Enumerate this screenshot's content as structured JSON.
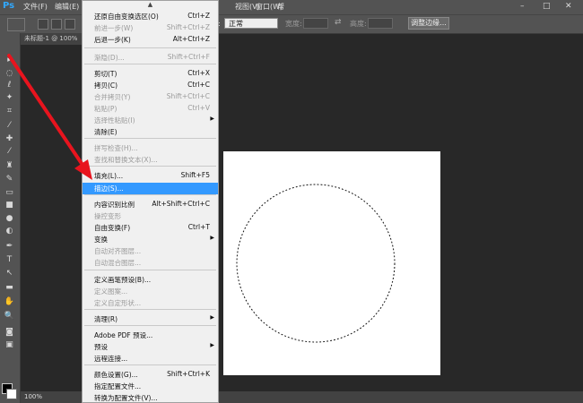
{
  "menubar": {
    "logo": "Ps",
    "file": "文件(F)",
    "edit": "编辑(E)",
    "view": "视图(V)",
    "window": "窗口(W)",
    "help": "帮",
    "minimize": "–",
    "maximize": "□",
    "close": "✕"
  },
  "options": {
    "style_label": "式:",
    "style_value": "正常",
    "width_label": "宽度:",
    "height_label": "高度:",
    "swap_icon": "⇄",
    "refine_button": "调整边缘..."
  },
  "document": {
    "tab_title": "未标题-1 @ 100%",
    "zoom": "100%"
  },
  "tools": [
    {
      "icon": "move-icon",
      "glyph": "▸"
    },
    {
      "icon": "marquee-icon",
      "glyph": "◌"
    },
    {
      "icon": "lasso-icon",
      "glyph": "ℓ"
    },
    {
      "icon": "magic-wand-icon",
      "glyph": "✦"
    },
    {
      "icon": "crop-icon",
      "glyph": "⌗"
    },
    {
      "icon": "eyedropper-icon",
      "glyph": "⁄"
    },
    {
      "icon": "healing-icon",
      "glyph": "✚"
    },
    {
      "icon": "brush-icon",
      "glyph": "⁄"
    },
    {
      "icon": "stamp-icon",
      "glyph": "♜"
    },
    {
      "icon": "history-brush-icon",
      "glyph": "✎"
    },
    {
      "icon": "eraser-icon",
      "glyph": "▭"
    },
    {
      "icon": "gradient-icon",
      "glyph": "■"
    },
    {
      "icon": "blur-icon",
      "glyph": "●"
    },
    {
      "icon": "dodge-icon",
      "glyph": "◐"
    },
    {
      "icon": "pen-icon",
      "glyph": "✒"
    },
    {
      "icon": "type-icon",
      "glyph": "T"
    },
    {
      "icon": "path-select-icon",
      "glyph": "↖"
    },
    {
      "icon": "shape-icon",
      "glyph": "▬"
    },
    {
      "icon": "hand-icon",
      "glyph": "✋"
    },
    {
      "icon": "zoom-icon",
      "glyph": "🔍"
    },
    {
      "icon": "quick-mask-icon",
      "glyph": "◙"
    },
    {
      "icon": "screen-mode-icon",
      "glyph": "▣"
    }
  ],
  "edit_menu": {
    "scroll_up": "▲",
    "items": [
      {
        "label": "还原自由变换选区(O)",
        "shortcut": "Ctrl+Z",
        "disabled": false
      },
      {
        "label": "前进一步(W)",
        "shortcut": "Shift+Ctrl+Z",
        "disabled": true
      },
      {
        "label": "后退一步(K)",
        "shortcut": "Alt+Ctrl+Z",
        "disabled": false
      },
      {
        "label": "渐隐(D)...",
        "shortcut": "Shift+Ctrl+F",
        "disabled": true
      },
      {
        "label": "剪切(T)",
        "shortcut": "Ctrl+X",
        "disabled": false
      },
      {
        "label": "拷贝(C)",
        "shortcut": "Ctrl+C",
        "disabled": false
      },
      {
        "label": "合并拷贝(Y)",
        "shortcut": "Shift+Ctrl+C",
        "disabled": true
      },
      {
        "label": "粘贴(P)",
        "shortcut": "Ctrl+V",
        "disabled": true
      },
      {
        "label": "选择性粘贴(I)",
        "shortcut": "",
        "disabled": true,
        "submenu": true
      },
      {
        "label": "清除(E)",
        "shortcut": "",
        "disabled": false
      },
      {
        "label": "拼写检查(H)...",
        "shortcut": "",
        "disabled": true
      },
      {
        "label": "查找和替换文本(X)...",
        "shortcut": "",
        "disabled": true
      },
      {
        "label": "填充(L)...",
        "shortcut": "Shift+F5",
        "disabled": false
      },
      {
        "label": "描边(S)...",
        "shortcut": "",
        "disabled": false,
        "highlighted": true
      },
      {
        "label": "内容识别比例",
        "shortcut": "Alt+Shift+Ctrl+C",
        "disabled": false
      },
      {
        "label": "操控变形",
        "shortcut": "",
        "disabled": true
      },
      {
        "label": "自由变换(F)",
        "shortcut": "Ctrl+T",
        "disabled": false
      },
      {
        "label": "变换",
        "shortcut": "",
        "disabled": false,
        "submenu": true
      },
      {
        "label": "自动对齐图层...",
        "shortcut": "",
        "disabled": true
      },
      {
        "label": "自动混合图层...",
        "shortcut": "",
        "disabled": true
      },
      {
        "label": "定义画笔预设(B)...",
        "shortcut": "",
        "disabled": false
      },
      {
        "label": "定义图案...",
        "shortcut": "",
        "disabled": true
      },
      {
        "label": "定义自定形状...",
        "shortcut": "",
        "disabled": true
      },
      {
        "label": "清理(R)",
        "shortcut": "",
        "disabled": false,
        "submenu": true
      },
      {
        "label": "Adobe PDF 预设...",
        "shortcut": "",
        "disabled": false
      },
      {
        "label": "预设",
        "shortcut": "",
        "disabled": false,
        "submenu": true
      },
      {
        "label": "远程连接...",
        "shortcut": "",
        "disabled": false
      },
      {
        "label": "颜色设置(G)...",
        "shortcut": "Shift+Ctrl+K",
        "disabled": false
      },
      {
        "label": "指定配置文件...",
        "shortcut": "",
        "disabled": false
      },
      {
        "label": "转换为配置文件(V)...",
        "shortcut": "",
        "disabled": false
      }
    ]
  },
  "colors": {
    "highlight": "#3399ff",
    "annotation_arrow": "#e8141e",
    "ps_blue": "#31a8ff"
  }
}
